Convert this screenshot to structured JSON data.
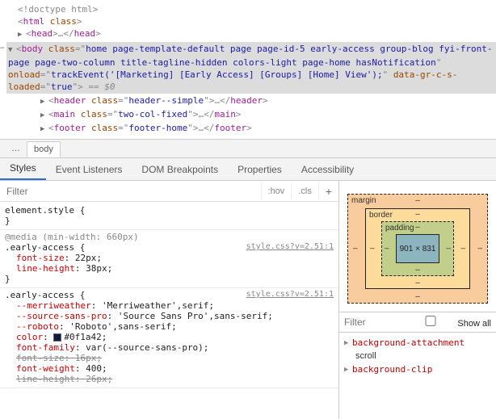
{
  "dom": {
    "doctype": "<!doctype html>",
    "html_open": "<html class=\"\">",
    "head": "<head>…</head>",
    "body_tag": "body",
    "body_class_attr": "class",
    "body_class": "home page-template-default page page-id-5 early-access group-blog fyi-front-page page-two-column title-tagline-hidden colors-light page-home hasNotification",
    "body_onload_attr": "onload",
    "body_onload": "trackEvent('[Marketing] [Early Access] [Groups] [Home] View');",
    "body_data_attr": "data-gr-c-s-loaded",
    "body_data_val": "true",
    "eq0": " == $0",
    "header_tag": "header",
    "header_class": "header--simple",
    "main_tag": "main",
    "main_class": "two-col-fixed",
    "footer_tag": "footer",
    "footer_class": "footer-home",
    "ellipsis": "…",
    "close_header": "</header>",
    "close_main": "</main>",
    "close_footer": "</footer>"
  },
  "crumbs": {
    "root": "…",
    "body": "body"
  },
  "tabs": [
    "Styles",
    "Event Listeners",
    "DOM Breakpoints",
    "Properties",
    "Accessibility"
  ],
  "filter": {
    "placeholder": "Filter",
    "hov": ":hov",
    "cls": ".cls"
  },
  "rules": {
    "element_style": "element.style {",
    "close": "}",
    "media": "@media (min-width: 660px)",
    "early_sel": ".early-access {",
    "src": "style.css?v=2.51:1",
    "r1p1n": "font-size",
    "r1p1v": "22px;",
    "r1p2n": "line-height",
    "r1p2v": "38px;",
    "r2p1n": "--merriweather",
    "r2p1v": "'Merriweather',serif;",
    "r2p2n": "--source-sans-pro",
    "r2p2v": "'Source Sans Pro',sans-serif;",
    "r2p3n": "--roboto",
    "r2p3v": "'Roboto',sans-serif;",
    "r2p4n": "color",
    "r2p4v": "#0f1a42;",
    "r2p5n": "font-family",
    "r2p5v": "var(--source-sans-pro);",
    "r2p6n": "font-size",
    "r2p6v": "16px;",
    "r2p7n": "font-weight",
    "r2p7v": "400;",
    "r2p8n": "line-height",
    "r2p8v": "26px;"
  },
  "box": {
    "margin": "margin",
    "border": "border",
    "padding": "padding",
    "content": "901 × 831",
    "dash": "–"
  },
  "rfilter": {
    "placeholder": "Filter",
    "showall": "Show all"
  },
  "computed": [
    {
      "name": "background-attachment",
      "val": "scroll"
    },
    {
      "name": "background-clip",
      "val": ""
    }
  ]
}
